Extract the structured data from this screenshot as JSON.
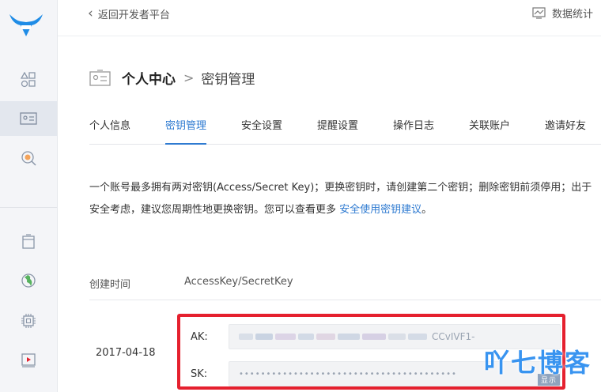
{
  "topbar": {
    "back_label": "返回开发者平台",
    "stats_label": "数据统计"
  },
  "heading": {
    "title": "个人中心",
    "separator": ">",
    "subtitle": "密钥管理"
  },
  "tabs": [
    {
      "label": "个人信息",
      "active": false
    },
    {
      "label": "密钥管理",
      "active": true
    },
    {
      "label": "安全设置",
      "active": false
    },
    {
      "label": "提醒设置",
      "active": false
    },
    {
      "label": "操作日志",
      "active": false
    },
    {
      "label": "关联账户",
      "active": false
    },
    {
      "label": "邀请好友",
      "active": false
    }
  ],
  "description": {
    "text": "一个账号最多拥有两对密钥(Access/Secret Key)；更换密钥时，请创建第二个密钥；删除密钥前须停用；出于安全考虑，建议您周期性地更换密钥。您可以查看更多 ",
    "link": "安全使用密钥建议",
    "suffix": "。"
  },
  "table": {
    "headers": [
      "创建时间",
      "AccessKey/SecretKey"
    ],
    "rows": [
      {
        "created": "2017-04-18",
        "ak_label": "AK:",
        "ak_visible_suffix": "CCvIVF1-",
        "sk_label": "SK:",
        "sk_masked": "••••••••••••••••••••••••••••••••••••••••",
        "show_label": "显示"
      }
    ]
  },
  "watermark": "吖七博客",
  "colors": {
    "accent": "#2f7bd1",
    "highlight_border": "#e5202e",
    "sidebar_bg": "#f4f5f8"
  },
  "icons": {
    "logo": "ox-head-logo",
    "sidebar": [
      "grid-icon",
      "id-card-icon",
      "coin-search-icon",
      "file-icon",
      "globe-icon",
      "chip-icon",
      "video-icon"
    ]
  }
}
